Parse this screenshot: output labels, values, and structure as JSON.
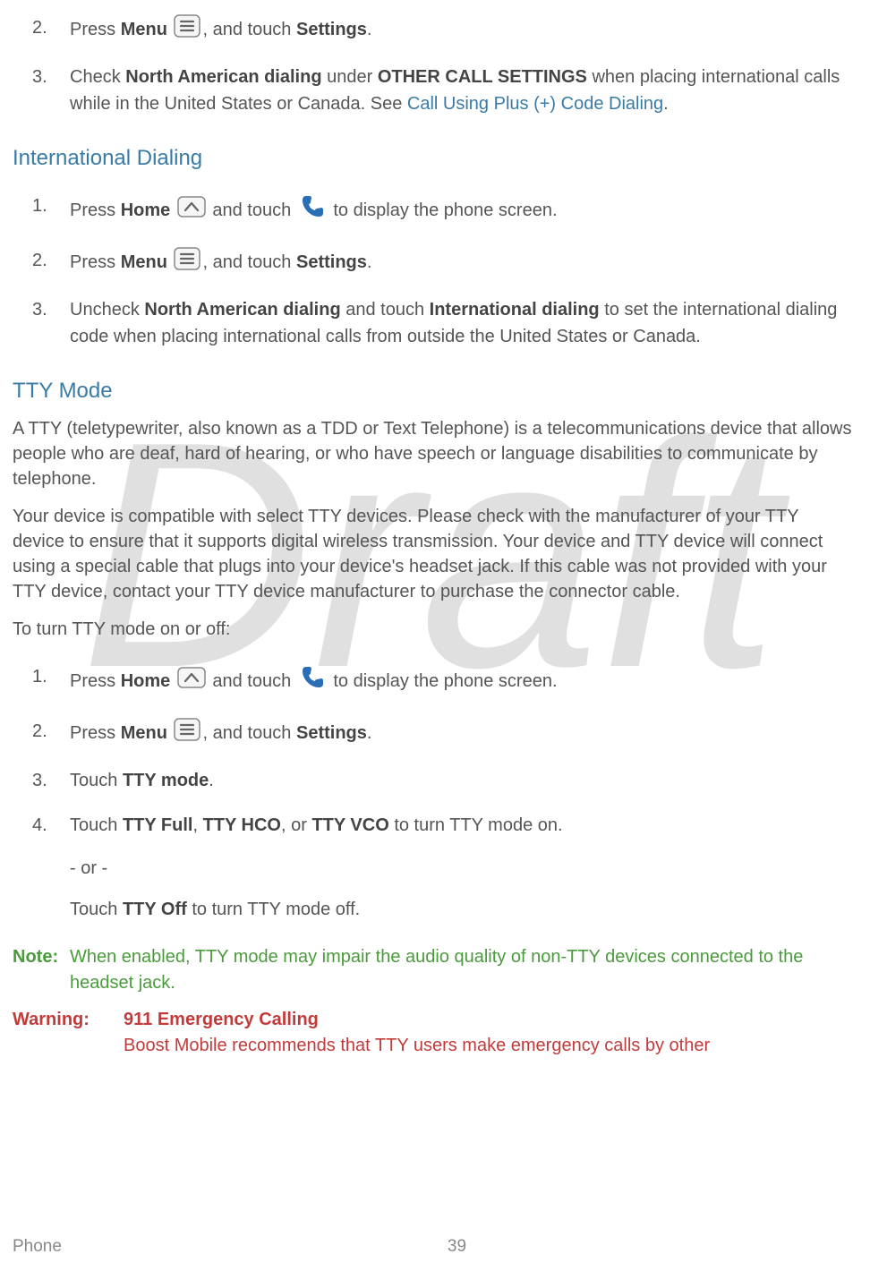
{
  "watermark": "Draft",
  "top_steps": [
    {
      "num": "2.",
      "parts": [
        "Press ",
        "Menu",
        " ",
        "ICON_MENU",
        ", and touch ",
        "Settings",
        "."
      ]
    },
    {
      "num": "3.",
      "parts": [
        "Check ",
        "North American dialing",
        " under ",
        "OTHER CALL SETTINGS",
        " when placing international calls while in the United States or Canada. See "
      ],
      "link": "Call Using Plus (+) Code Dialing",
      "after_link": "."
    }
  ],
  "intl": {
    "heading": "International Dialing",
    "steps": [
      {
        "num": "1.",
        "parts": [
          "Press ",
          "Home",
          " ",
          "ICON_HOME",
          " and touch ",
          "ICON_PHONE",
          " to display the phone screen."
        ]
      },
      {
        "num": "2.",
        "parts": [
          "Press ",
          "Menu",
          " ",
          "ICON_MENU",
          ", and touch ",
          "Settings",
          "."
        ]
      },
      {
        "num": "3.",
        "parts": [
          "Uncheck ",
          "North American dialing",
          " and touch ",
          "International dialing",
          " to set the international dialing code when placing international calls from outside the United States or Canada."
        ]
      }
    ]
  },
  "tty": {
    "heading": "TTY Mode",
    "para1": "A TTY (teletypewriter, also known as a TDD or Text Telephone) is a telecommunications device that allows people who are deaf, hard of hearing, or who have speech or language disabilities to communicate by telephone.",
    "para2": "Your device is compatible with select TTY devices. Please check with the manufacturer of your TTY device to ensure that it supports digital wireless transmission. Your device and TTY device will connect using a special cable that plugs into your device's headset jack. If this cable was not provided with your TTY device, contact your TTY device manufacturer to purchase the connector cable.",
    "para3": "To turn TTY mode on or off:",
    "steps": [
      {
        "num": "1.",
        "parts": [
          "Press ",
          "Home",
          " ",
          "ICON_HOME",
          " and touch ",
          "ICON_PHONE",
          " to display the phone screen."
        ]
      },
      {
        "num": "2.",
        "parts": [
          "Press ",
          "Menu",
          " ",
          "ICON_MENU",
          ", and touch ",
          "Settings",
          "."
        ]
      },
      {
        "num": "3.",
        "parts": [
          "Touch ",
          "TTY mode",
          "."
        ]
      },
      {
        "num": "4.",
        "parts": [
          "Touch ",
          "TTY Full",
          ", ",
          "TTY HCO",
          ", or ",
          "TTY VCO",
          " to turn TTY mode on."
        ]
      }
    ],
    "or": "- or -",
    "off": [
      "Touch ",
      "TTY Off",
      " to turn TTY mode off."
    ]
  },
  "note": {
    "label": "Note:",
    "text": "When enabled, TTY mode may impair the audio quality of non-TTY devices connected to the headset jack."
  },
  "warning": {
    "label": "Warning:",
    "title": "911 Emergency Calling",
    "text": "Boost Mobile recommends that TTY users make emergency calls by other"
  },
  "footer": {
    "section": "Phone",
    "page": "39"
  }
}
